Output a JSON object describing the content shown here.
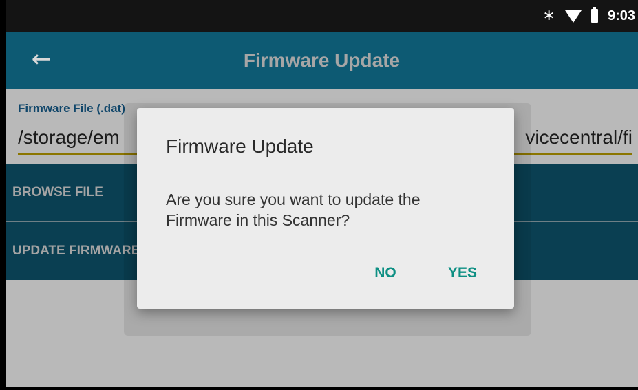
{
  "status_bar": {
    "time": "9:03",
    "icons": [
      "bluetooth-icon",
      "wifi-icon",
      "battery-icon"
    ]
  },
  "app_bar": {
    "back_icon": "←",
    "title": "Firmware Update"
  },
  "form": {
    "field_label": "Firmware File (.dat)",
    "field_value_left": "/storage/em",
    "field_value_right": "vicecentral/fi",
    "browse_label": "BROWSE FILE",
    "update_label": "UPDATE FIRMWARE"
  },
  "dialog": {
    "title": "Firmware Update",
    "message": "Are you sure you want to update the Firmware in this Scanner?",
    "no_label": "NO",
    "yes_label": "YES"
  },
  "colors": {
    "status_bar": "#141414",
    "app_bar": "#0d5a73",
    "action_row": "#0a3f52",
    "accent": "#0d8f83",
    "field_underline": "#8b7600"
  }
}
